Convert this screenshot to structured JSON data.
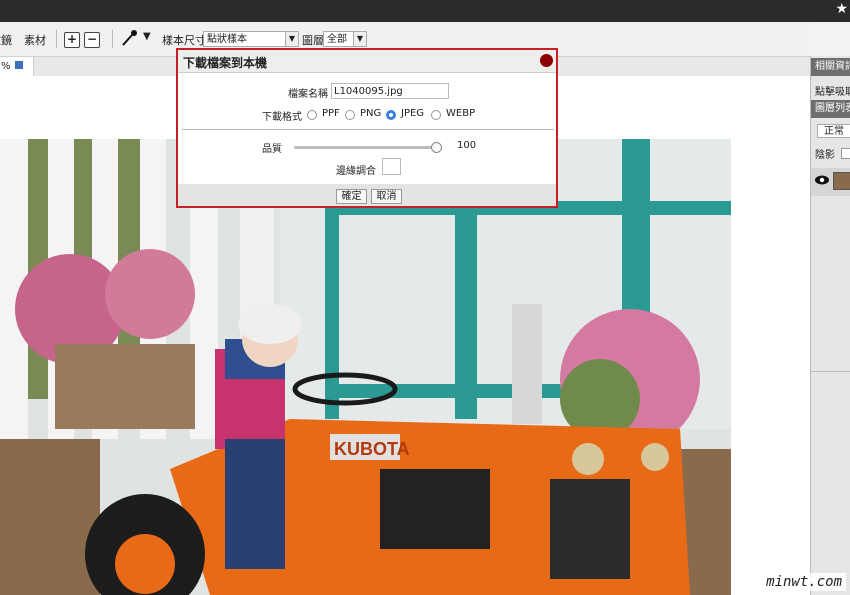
{
  "toolbar": {
    "filter_label": "濾鏡",
    "material_label": "素材",
    "sample_size_label": "樣本尺寸",
    "sample_size_value": "點狀樣本",
    "layer_label": "圖層",
    "layer_value": "全部"
  },
  "document_tab": {
    "zoom": "%"
  },
  "panel": {
    "info_header": "相關資訊",
    "info_text": "點擊吸取",
    "layers_header": "圖層列表",
    "blend_mode": "正常",
    "shadow_label": "陰影"
  },
  "dialog": {
    "title": "下載檔案到本機",
    "filename_label": "檔案名稱",
    "filename_value": "L1040095.jpg",
    "format_label": "下載格式",
    "formats": [
      "PPF",
      "PNG",
      "JPEG",
      "WEBP"
    ],
    "selected_format": "JPEG",
    "quality_label": "品質",
    "quality_value": "100",
    "quality_fraction": 1.0,
    "edge_label": "邊緣調合",
    "ok_label": "確定",
    "cancel_label": "取消"
  },
  "watermark": "minwt.com"
}
